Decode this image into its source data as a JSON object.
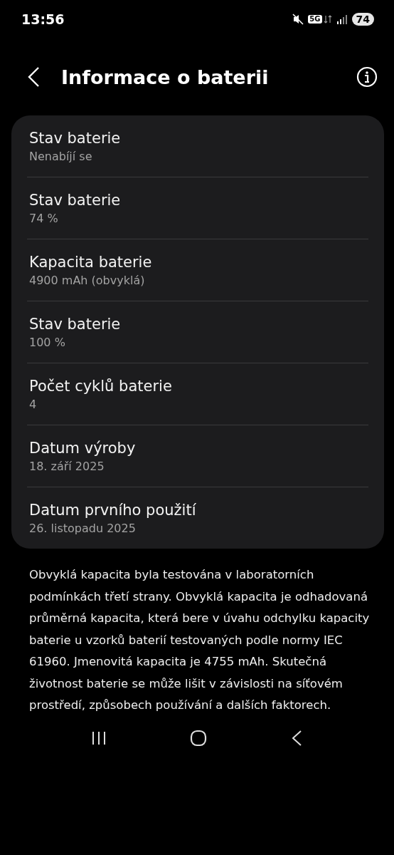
{
  "status_bar": {
    "time": "13:56",
    "network": "5G",
    "battery": "74"
  },
  "header": {
    "title": "Informace o baterii"
  },
  "items": [
    {
      "title": "Stav baterie",
      "value": "Nenabíjí se"
    },
    {
      "title": "Stav baterie",
      "value": "74 %"
    },
    {
      "title": "Kapacita baterie",
      "value": "4900 mAh (obvyklá)"
    },
    {
      "title": "Stav baterie",
      "value": "100 %"
    },
    {
      "title": "Počet cyklů baterie",
      "value": "4"
    },
    {
      "title": "Datum výroby",
      "value": "18. září 2025"
    },
    {
      "title": "Datum prvního použití",
      "value": "26. listopadu 2025"
    }
  ],
  "note": "Obvyklá kapacita byla testována v laboratorních podmínkách třetí strany. Obvyklá kapacita je odhadovaná průměrná kapacita, která bere v úvahu odchylku kapacity baterie u vzorků baterií testovaných podle normy IEC 61960. Jmenovitá kapacita je 4755 mAh. Skutečná životnost baterie se může lišit v závislosti na síťovém prostředí, způsobech používání a dalších faktorech."
}
